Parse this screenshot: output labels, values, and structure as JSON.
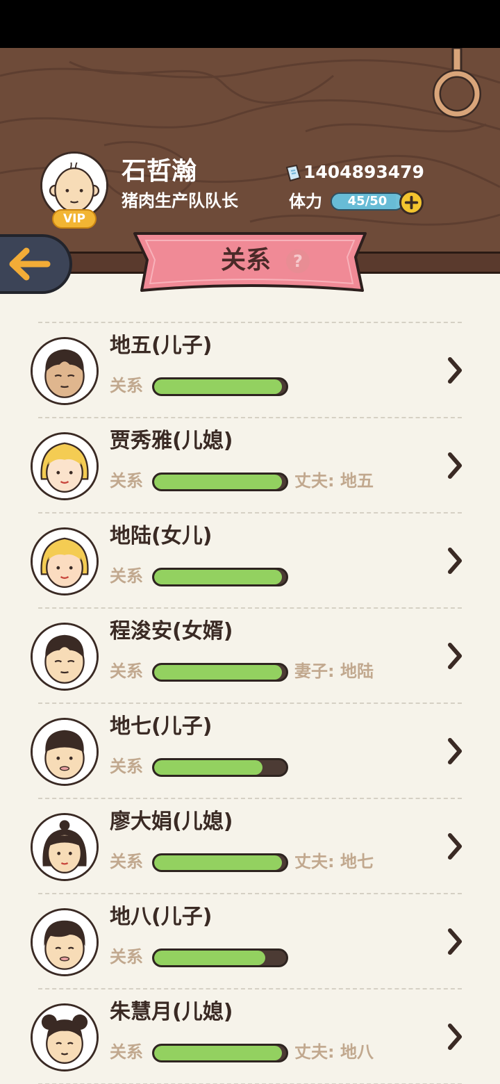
{
  "header": {
    "player_name": "石哲瀚",
    "player_title": "猪肉生产队队长",
    "player_id": "1404893479",
    "vip_label": "VIP",
    "stamina_label": "体力",
    "stamina_text": "45/50",
    "stamina_current": 45,
    "stamina_max": 50,
    "id_icon": "ticket-icon",
    "add_icon": "plus-icon"
  },
  "nav": {
    "back_icon": "back-arrow-icon",
    "title": "关系",
    "help_label": "?"
  },
  "relation_label": "关系",
  "members": [
    {
      "name": "地五(儿子)",
      "relationship": 0.97,
      "spouse": ""
    },
    {
      "name": "贾秀雅(儿媳)",
      "relationship": 0.97,
      "spouse": "丈夫: 地五"
    },
    {
      "name": "地陆(女儿)",
      "relationship": 0.97,
      "spouse": ""
    },
    {
      "name": "程浚安(女婿)",
      "relationship": 0.97,
      "spouse": "妻子: 地陆"
    },
    {
      "name": "地七(儿子)",
      "relationship": 0.82,
      "spouse": ""
    },
    {
      "name": "廖大娟(儿媳)",
      "relationship": 0.97,
      "spouse": "丈夫: 地七"
    },
    {
      "name": "地八(儿子)",
      "relationship": 0.84,
      "spouse": ""
    },
    {
      "name": "朱慧月(儿媳)",
      "relationship": 0.97,
      "spouse": "丈夫: 地八"
    }
  ],
  "colors": {
    "wood": "#6e4b39",
    "background": "#f6f3ea",
    "banner": "#f08a96",
    "relation_fill": "#93d160",
    "stamina_fill": "#68bcd6"
  }
}
